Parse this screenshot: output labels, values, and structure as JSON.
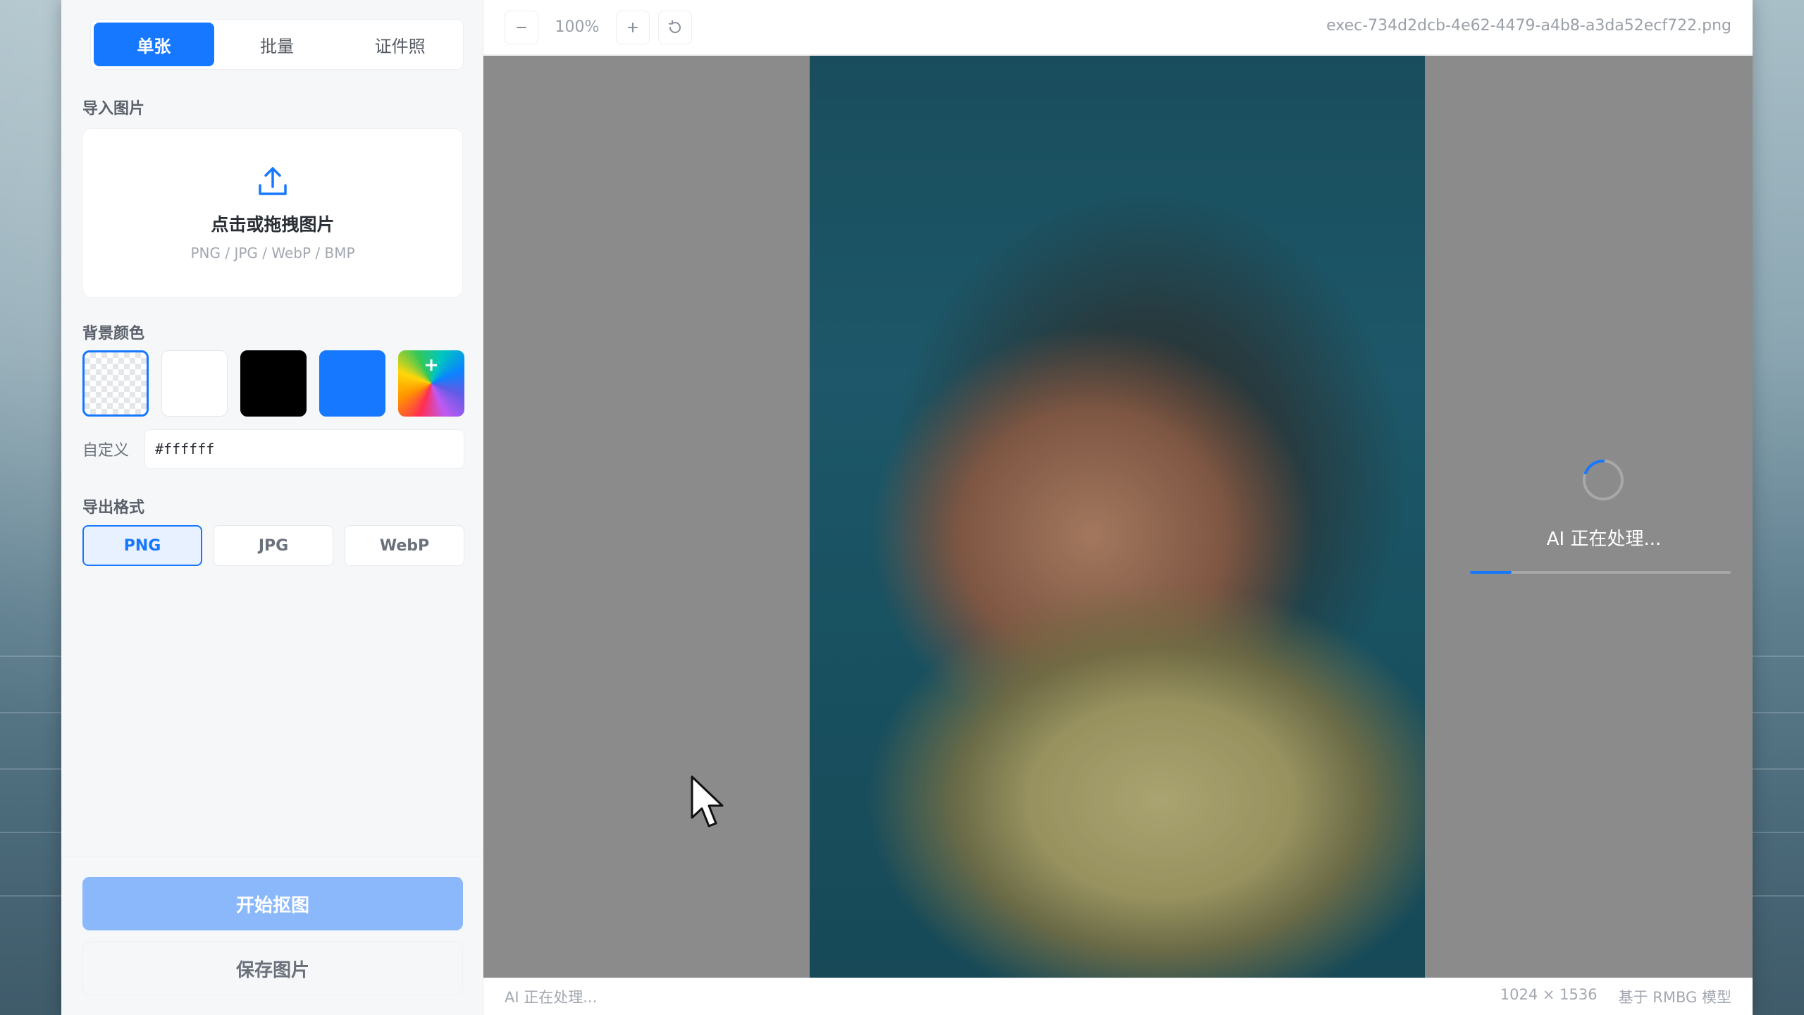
{
  "mode_tabs": {
    "single": "单张",
    "batch": "批量",
    "id_photo": "证件照"
  },
  "import": {
    "section_label": "导入图片",
    "dropzone_title": "点击或拖拽图片",
    "dropzone_hint": "PNG / JPG / WebP / BMP"
  },
  "background": {
    "section_label": "背景颜色",
    "swatches": [
      "transparent",
      "#ffffff",
      "#000000",
      "#1677ff",
      "custom-rainbow"
    ],
    "selected": "transparent",
    "custom_label": "自定义",
    "custom_value": "#ffffff"
  },
  "export": {
    "section_label": "导出格式",
    "formats": [
      "PNG",
      "JPG",
      "WebP"
    ],
    "selected": "PNG"
  },
  "actions": {
    "start": "开始抠图",
    "save": "保存图片"
  },
  "toolbar": {
    "zoom_out_icon": "minus-icon",
    "zoom_level": "100%",
    "zoom_in_icon": "plus-icon",
    "reset_icon": "rotate-ccw-icon",
    "filename": "exec-734d2dcb-4e62-4479-a4b8-a3da52ecf722.png"
  },
  "processing": {
    "message": "AI 正在处理...",
    "progress": 0.16
  },
  "status": {
    "left": "AI 正在处理...",
    "dimensions": "1024 × 1536",
    "model": "基于 RMBG 模型"
  },
  "colors": {
    "accent": "#1677ff",
    "primary_disabled": "#8ab8fb"
  }
}
